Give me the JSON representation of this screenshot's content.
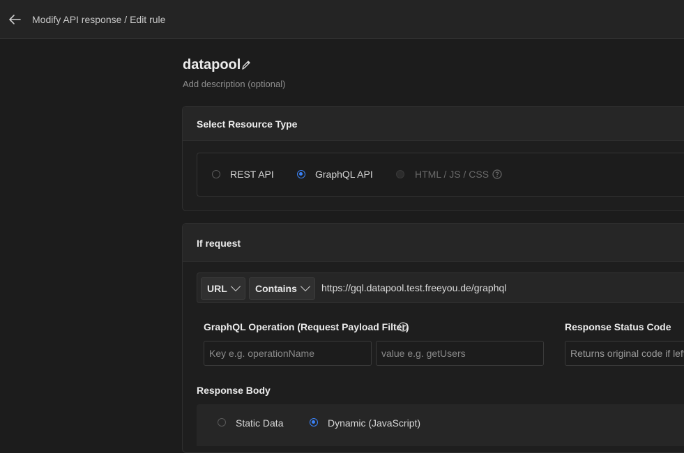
{
  "header": {
    "breadcrumb": "Modify API response / Edit rule",
    "back_icon": "arrow-left-icon"
  },
  "rule": {
    "name": "datapool",
    "description_placeholder": "Add description (optional)"
  },
  "resource_type": {
    "title": "Select Resource Type",
    "options": [
      {
        "label": "REST API",
        "selected": false,
        "disabled": false
      },
      {
        "label": "GraphQL API",
        "selected": true,
        "disabled": false
      },
      {
        "label": "HTML / JS / CSS",
        "selected": false,
        "disabled": true
      }
    ]
  },
  "request": {
    "title": "If request",
    "source_dropdown": "URL",
    "operator_dropdown": "Contains",
    "url_value": "https://gql.datapool.test.freeyou.de/graphql",
    "graphql_label": "GraphQL Operation (Request Payload Filter)",
    "key_placeholder": "Key e.g. operationName",
    "value_placeholder": "value e.g. getUsers",
    "status_label": "Response Status Code",
    "status_placeholder": "Returns original code if left empty"
  },
  "response_body": {
    "label": "Response Body",
    "options": [
      {
        "label": "Static Data",
        "selected": false
      },
      {
        "label": "Dynamic (JavaScript)",
        "selected": true
      }
    ]
  },
  "colors": {
    "accent": "#3b82f6",
    "background": "#1c1c1c",
    "panel": "#262626"
  }
}
